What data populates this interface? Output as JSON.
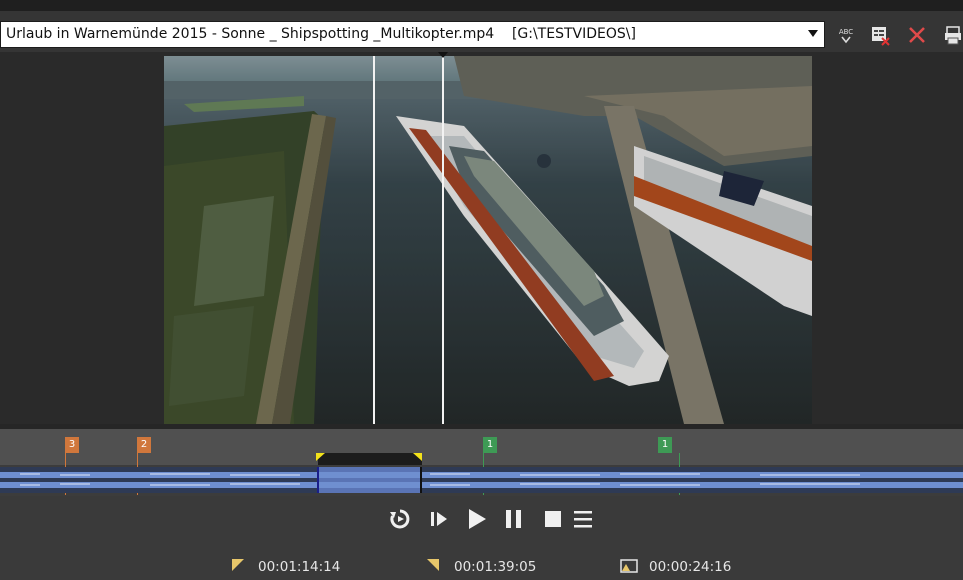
{
  "toolbar": {
    "file_title": "Urlaub in Warnemünde 2015 - Sonne _ Shipspotting _Multikopter.mp4    [G:\\TESTVIDEOS\\]",
    "icons": [
      "abc-spellcheck-icon",
      "properties-icon",
      "close-icon",
      "print-icon"
    ],
    "spell_label": "ABC"
  },
  "markers": [
    {
      "label": "3",
      "color": "#d0773c"
    },
    {
      "label": "2",
      "color": "#d0773c"
    },
    {
      "label": "1",
      "color": "#3e9a55"
    },
    {
      "label": "1",
      "color": "#3e9a55"
    }
  ],
  "transport": {
    "buttons": [
      "loop-icon",
      "play-selection-icon",
      "play-icon",
      "pause-icon",
      "stop-icon",
      "menu-icon"
    ]
  },
  "timecodes": {
    "in_point": "00:01:14:14",
    "out_point": "00:01:39:05",
    "duration": "00:00:24:16"
  },
  "colors": {
    "marker_orange": "#d0773c",
    "marker_green": "#3e9a55",
    "selection_yellow": "#f3e21a",
    "waveform_blue": "#6f8fd0"
  }
}
